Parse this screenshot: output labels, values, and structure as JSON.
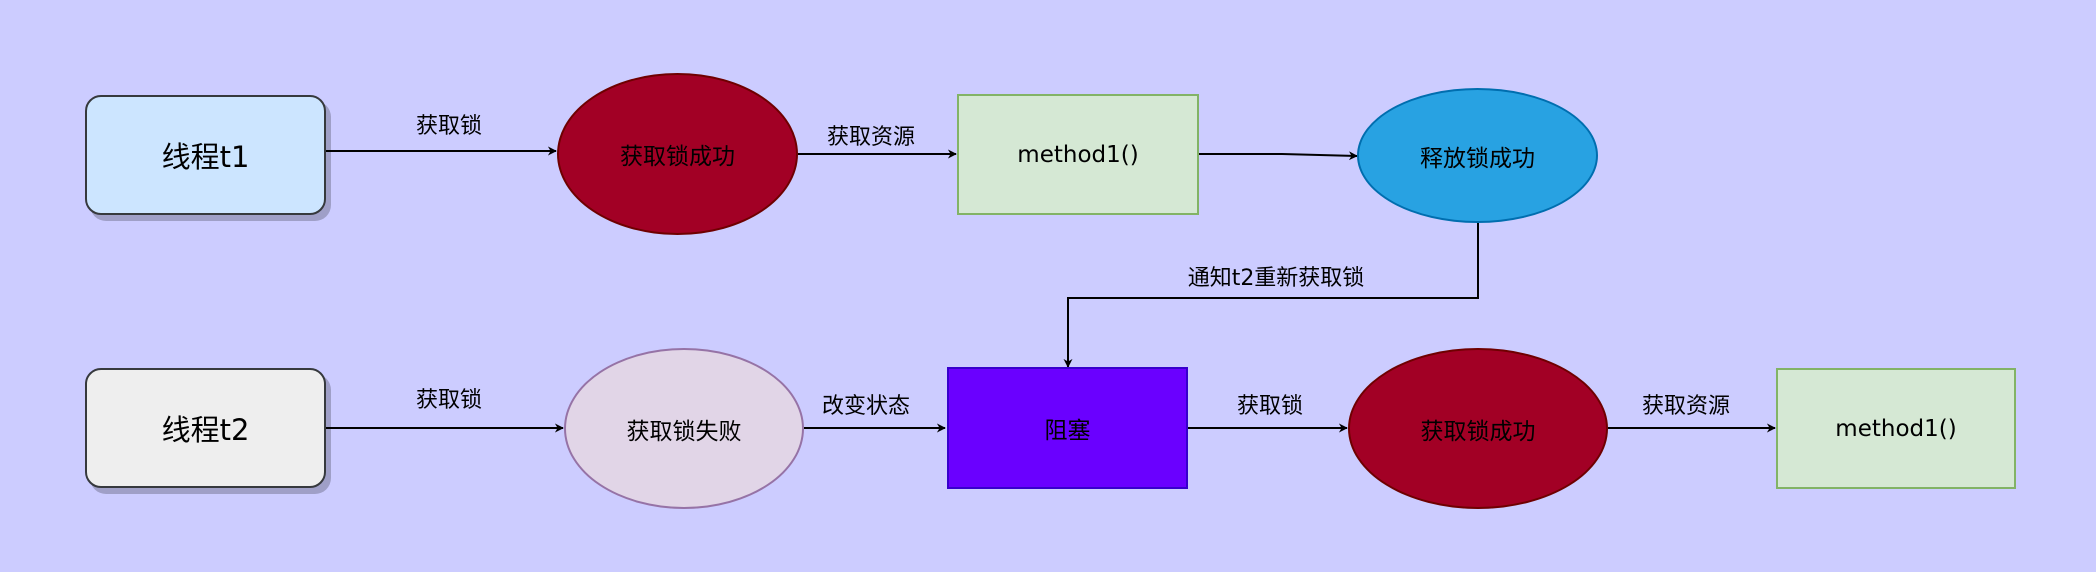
{
  "colors": {
    "background": "#ccccff",
    "thread1_fill": "#cce5ff",
    "thread2_fill": "#eeeeee",
    "success_fill": "#a20025",
    "release_fill": "#28a2e2",
    "fail_fill": "#e1d5e7",
    "method_fill": "#d5e8d4",
    "blocked_fill": "#6a00ff",
    "edge": "#000000"
  },
  "nodes": {
    "thread1": "线程t1",
    "acquire_success_1": "获取锁成功",
    "method1_a": "method1()",
    "release_success": "释放锁成功",
    "thread2": "线程t2",
    "acquire_fail": "获取锁失败",
    "blocked": "阻塞",
    "acquire_success_2": "获取锁成功",
    "method1_b": "method1()"
  },
  "edges": {
    "t1_acquire": "获取锁",
    "t1_get_resource": "获取资源",
    "notify_t2": "通知t2重新获取锁",
    "t2_acquire": "获取锁",
    "change_state": "改变状态",
    "blocked_acquire": "获取锁",
    "t2_get_resource": "获取资源"
  }
}
